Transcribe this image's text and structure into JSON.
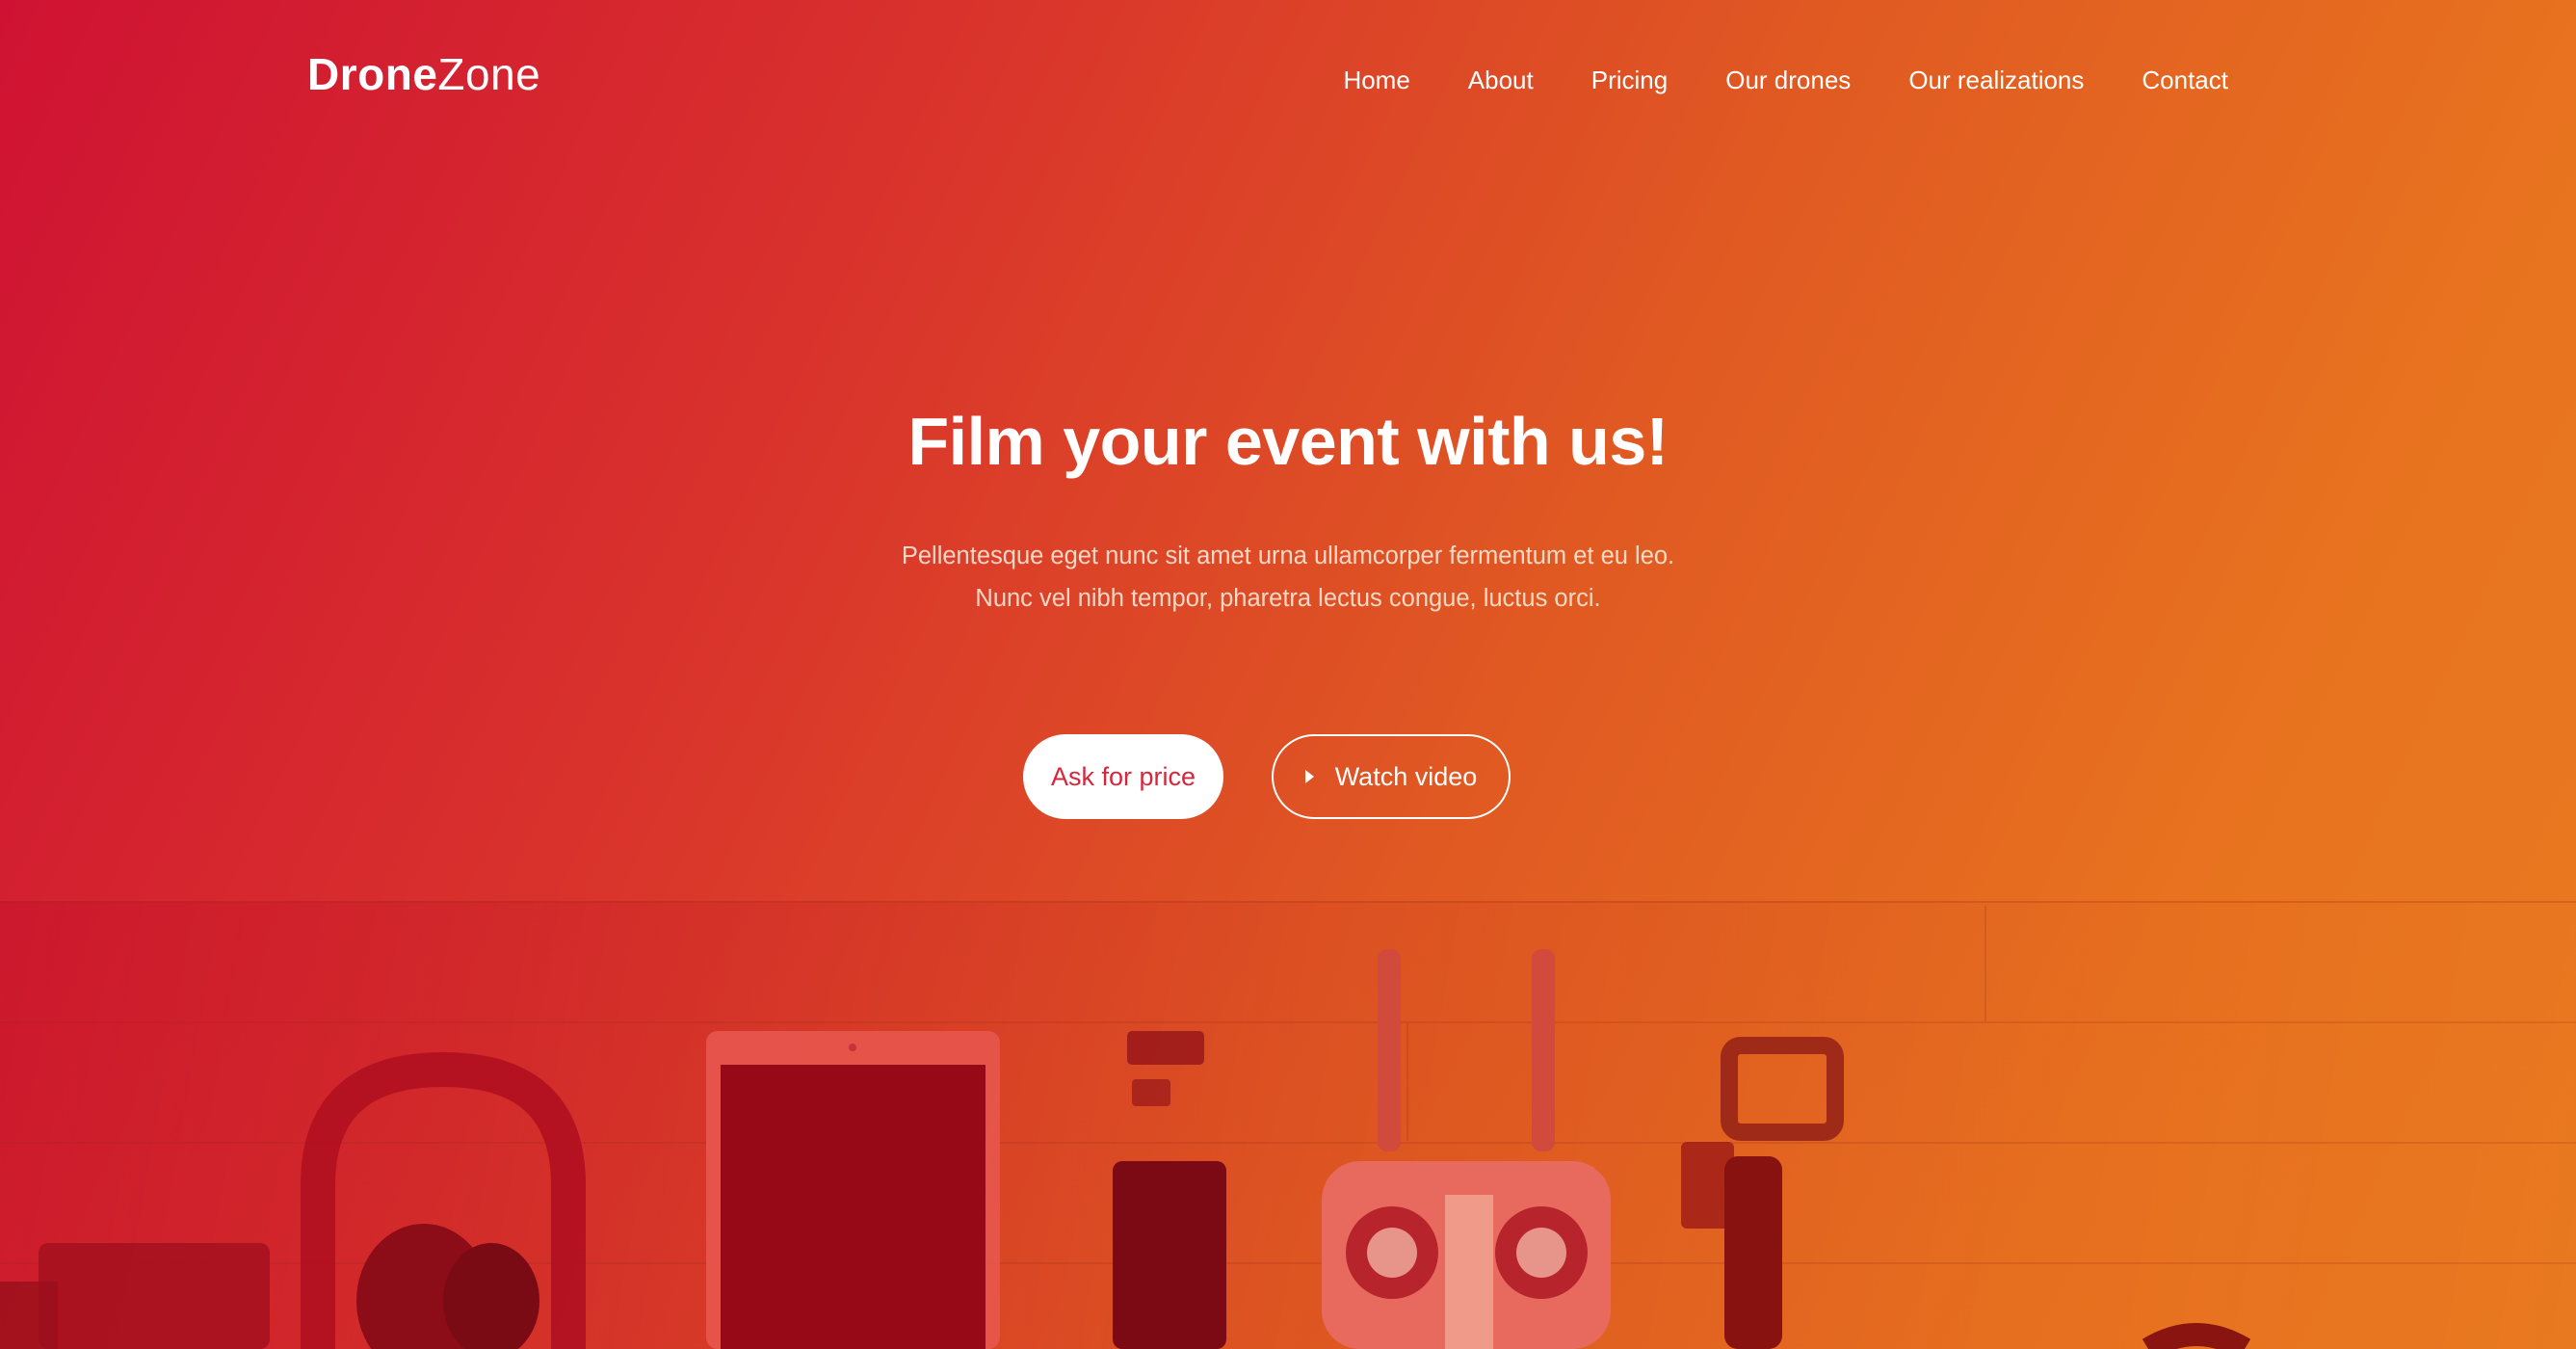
{
  "brand": {
    "bold": "Drone",
    "light": "Zone"
  },
  "nav": {
    "items": [
      {
        "label": "Home"
      },
      {
        "label": "About"
      },
      {
        "label": "Pricing"
      },
      {
        "label": "Our drones"
      },
      {
        "label": "Our realizations"
      },
      {
        "label": "Contact"
      }
    ]
  },
  "hero": {
    "title": "Film your event with us!",
    "subtitle_line1": "Pellentesque eget nunc sit amet urna ullamcorper fermentum et eu leo.",
    "subtitle_line2": "Nunc vel nibh tempor, pharetra lectus congue, luctus orci.",
    "primary_button": "Ask for price",
    "secondary_button": "Watch video"
  },
  "colors": {
    "gradient_left": "#cf1233",
    "gradient_right": "#e97a20",
    "primary_button_text": "#d8253b"
  },
  "icons": {
    "play": "play-icon"
  }
}
